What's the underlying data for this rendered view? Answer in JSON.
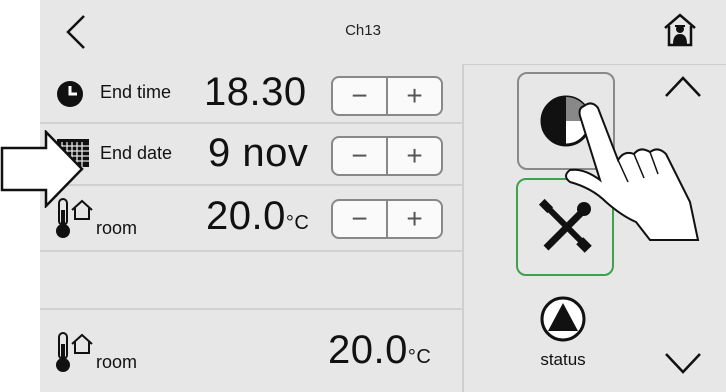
{
  "header": {
    "title": "Ch13"
  },
  "rows": [
    {
      "label": "End time",
      "value": "18.30",
      "minus": "−",
      "plus": "+"
    },
    {
      "label": "End date",
      "value": "9 nov",
      "minus": "−",
      "plus": "+"
    },
    {
      "label": "room",
      "value": "20.0",
      "unit": "°C",
      "minus": "−",
      "plus": "+"
    }
  ],
  "bottom_row": {
    "label": "room",
    "value": "20.0",
    "unit": "°C"
  },
  "side": {
    "status_label": "status"
  },
  "icons": {
    "back": "chevron-left-icon",
    "home": "home-icon",
    "up": "chevron-up-icon",
    "down": "chevron-down-icon",
    "mode": "pie-mode-icon",
    "tools": "wrench-screwdriver-icon",
    "status": "triangle-circle-icon"
  }
}
